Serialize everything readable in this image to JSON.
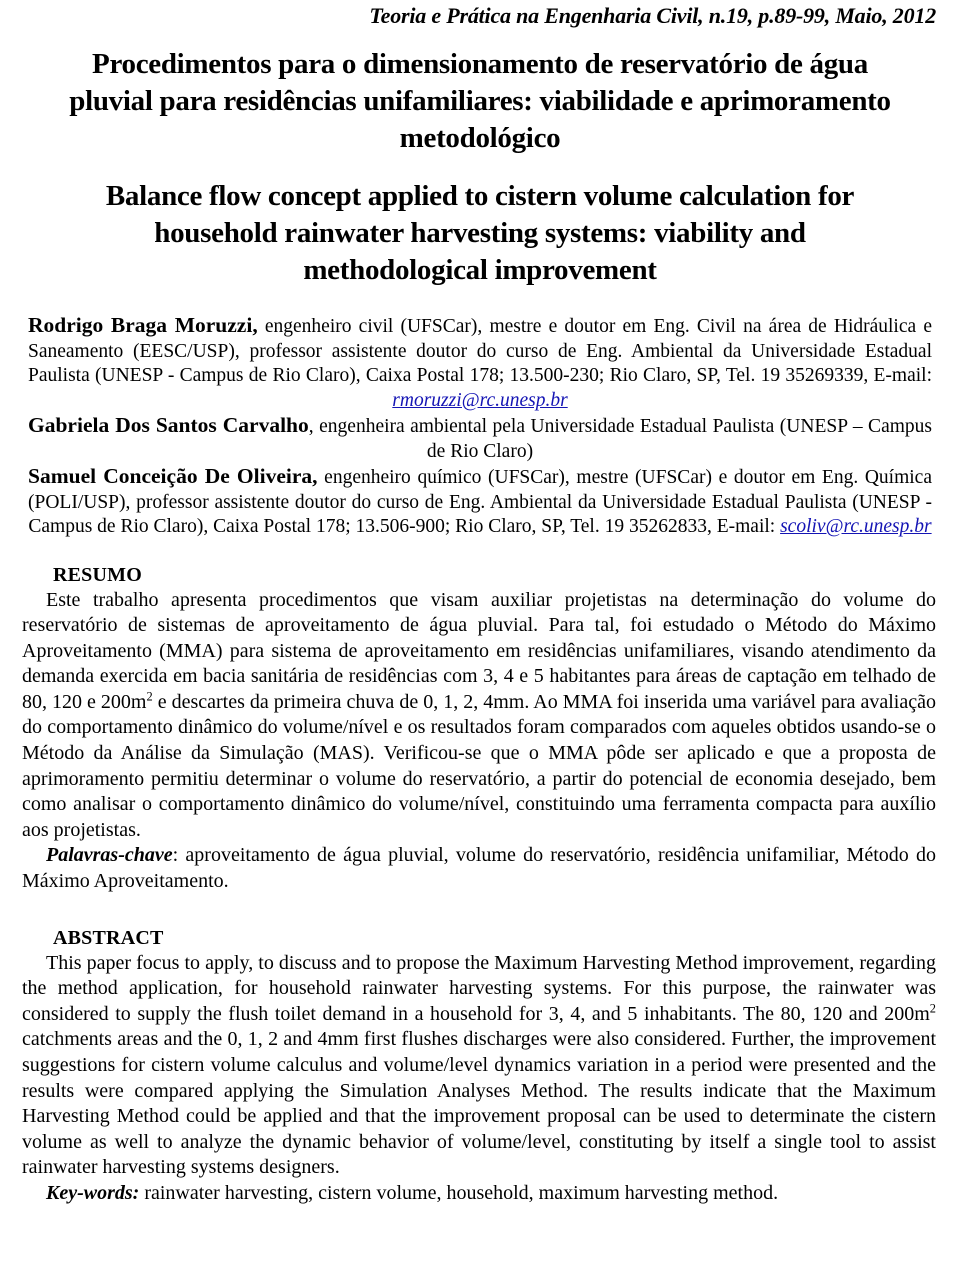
{
  "running_head": "Teoria e Prática na Engenharia Civil, n.19, p.89-99, Maio, 2012",
  "title": {
    "portuguese": "Procedimentos para o dimensionamento de reservatório de água pluvial para residências unifamiliares: viabilidade e aprimoramento metodológico",
    "english": "Balance flow concept applied to cistern volume calculation for household rainwater harvesting systems: viability and methodological improvement"
  },
  "authors": [
    {
      "name": "Rodrigo Braga Moruzzi,",
      "affiliation_before_email": " engenheiro civil (UFSCar), mestre e doutor em Eng. Civil na área de Hidráulica e Saneamento (EESC/USP), professor assistente doutor do curso de Eng. Ambiental da Universidade Estadual Paulista (UNESP - Campus de Rio Claro), Caixa Postal 178; 13.500-230; Rio Claro, SP, Tel. 19 35269339, E-mail: ",
      "email": "rmoruzzi@rc.unesp.br"
    },
    {
      "name": "Gabriela Dos Santos Carvalho",
      "affiliation_before_email": ", engenheira ambiental pela Universidade Estadual Paulista (UNESP – Campus de Rio Claro)",
      "email": ""
    },
    {
      "name": "Samuel Conceição De Oliveira,",
      "affiliation_before_email": " engenheiro químico (UFSCar), mestre (UFSCar) e doutor em Eng. Química (POLI/USP), professor assistente doutor do curso de Eng. Ambiental da Universidade Estadual Paulista (UNESP - Campus de Rio Claro), Caixa Postal 178; 13.506-900; Rio Claro, SP, Tel. 19 35262833, E-mail: ",
      "email": "scoliv@rc.unesp.br"
    }
  ],
  "resumo": {
    "heading": "RESUMO",
    "paragraph_part1": "Este trabalho apresenta procedimentos que visam auxiliar projetistas na determinação do volume do reservatório de sistemas de aproveitamento de água pluvial. Para tal, foi estudado o Método do Máximo Aproveitamento (MMA) para sistema de aproveitamento em residências unifamiliares, visando atendimento da demanda exercida em bacia sanitária de residências com 3, 4 e 5 habitantes para áreas de captação em telhado de 80, 120 e 200m",
    "superscript": "2",
    "paragraph_part2": " e descartes da primeira chuva de 0, 1, 2, 4mm. Ao MMA foi inserida uma variável para avaliação do comportamento dinâmico do volume/nível e os resultados foram comparados com aqueles obtidos usando-se o Método da Análise da Simulação (MAS). Verificou-se que o MMA pôde ser aplicado e que a proposta de aprimoramento permitiu determinar o volume do reservatório, a partir do potencial de economia desejado, bem como analisar o comportamento dinâmico do volume/nível, constituindo uma ferramenta compacta para auxílio aos projetistas.",
    "keywords_label": "Palavras-chave",
    "keywords_text": ": aproveitamento de água pluvial, volume do reservatório, residência unifamiliar, Método do Máximo Aproveitamento."
  },
  "abstract": {
    "heading": "ABSTRACT",
    "paragraph_part1": "This paper focus to apply, to discuss and to propose the Maximum Harvesting Method improvement, regarding the method application, for household rainwater harvesting systems. For this purpose, the rainwater was considered to supply the flush toilet demand in a household for 3, 4, and 5 inhabitants. The 80, 120 and 200m",
    "superscript": "2",
    "paragraph_part2": " catchments areas and the 0, 1, 2 and 4mm first flushes discharges were also considered. Further, the improvement suggestions for cistern volume calculus and volume/level dynamics variation in a period were presented and the results were compared applying the Simulation Analyses Method. The results indicate that the Maximum Harvesting Method could be applied and that the improvement proposal can be used to determinate the cistern volume as well to analyze the dynamic behavior of volume/level, constituting by itself a single tool to assist rainwater harvesting systems designers.",
    "keywords_label": "Key-words:",
    "keywords_text": " rainwater harvesting, cistern volume, household, maximum harvesting method."
  },
  "colors": {
    "text": "#000000",
    "link": "#1414b4",
    "background": "#ffffff"
  }
}
